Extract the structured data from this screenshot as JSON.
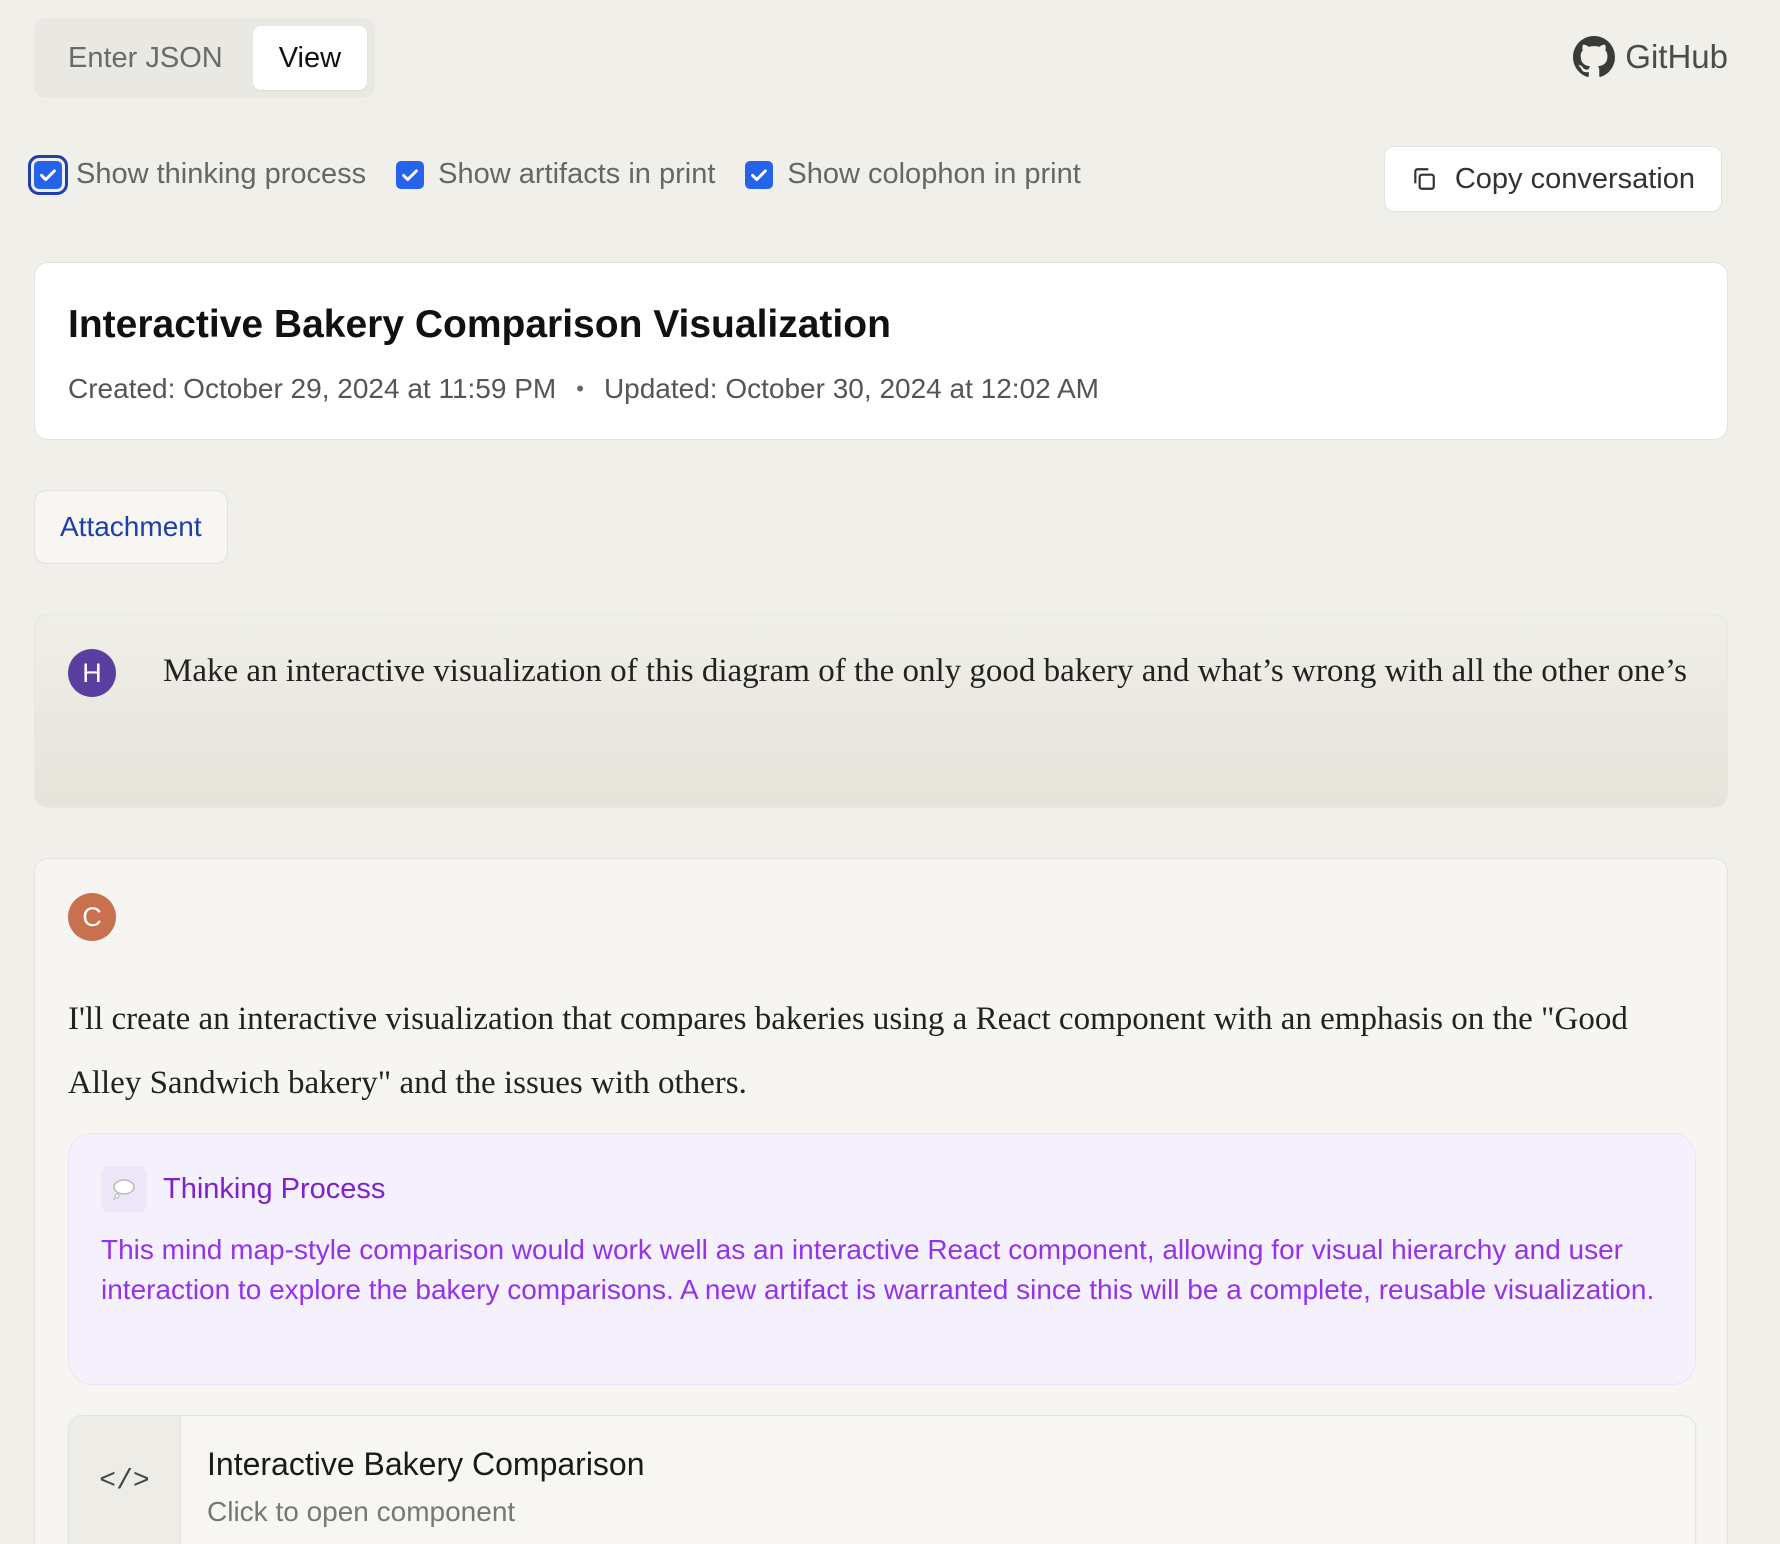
{
  "topbar": {
    "tabs": [
      {
        "label": "Enter JSON"
      },
      {
        "label": "View"
      }
    ],
    "active_tab": "View",
    "github_label": "GitHub"
  },
  "options": {
    "show_thinking": {
      "label": "Show thinking process",
      "checked": true
    },
    "show_artifacts": {
      "label": "Show artifacts in print",
      "checked": true
    },
    "show_colophon": {
      "label": "Show colophon in print",
      "checked": true
    },
    "copy_label": "Copy conversation"
  },
  "conversation": {
    "title": "Interactive Bakery Comparison Visualization",
    "created": "Created: October 29, 2024 at 11:59 PM",
    "separator": "•",
    "updated": "Updated: October 30, 2024 at 12:02 AM"
  },
  "attachment_label": "Attachment",
  "messages": {
    "human": {
      "avatar": "H",
      "text": "Make an interactive visualization of this diagram of the only good bakery and what’s wrong with all the other one’s"
    },
    "assistant": {
      "avatar": "C",
      "text": "I'll create an interactive visualization that compares bakeries using a React component with an emphasis on the \"Good Alley Sandwich bakery\" and the issues with others.",
      "thinking": {
        "icon": "thought-bubble-icon",
        "title": "Thinking Process",
        "body": "This mind map-style comparison would work well as an interactive React component, allowing for visual hierarchy and user interaction to explore the bakery comparisons. A new artifact is warranted since this will be a complete, reusable visualization."
      },
      "artifact": {
        "icon": "code-icon",
        "icon_text": "</>",
        "title": "Interactive Bakery Comparison",
        "subtitle": "Click to open component"
      }
    }
  },
  "colors": {
    "background": "#f0efea",
    "checkbox": "#2563eb",
    "link": "#1d3fa8",
    "thinking_text": "#9333ea",
    "human_avatar": "#5a3fa0",
    "assistant_avatar": "#c9714e"
  }
}
